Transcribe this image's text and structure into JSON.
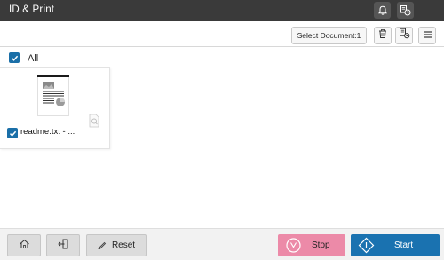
{
  "titlebar": {
    "title": "ID & Print",
    "icons": [
      "bell-icon",
      "job-status-icon"
    ]
  },
  "toolbar": {
    "select_document_label": "Select Document:1",
    "icons": [
      "trash-icon",
      "print-settings-icon",
      "menu-icon"
    ]
  },
  "selection": {
    "all_label": "All",
    "all_checked": true
  },
  "documents": [
    {
      "name": "readme.txt  -  ...",
      "checked": true
    }
  ],
  "footer": {
    "reset_label": "Reset",
    "stop_label": "Stop",
    "start_label": "Start",
    "icons": [
      "home-icon",
      "logout-icon",
      "reset-icon",
      "stop-icon",
      "start-icon"
    ]
  },
  "colors": {
    "titlebar_bg": "#3a3a3a",
    "checkbox": "#1a6fa8",
    "stop_button": "#ec8aa8",
    "start_button": "#1a72b0"
  }
}
